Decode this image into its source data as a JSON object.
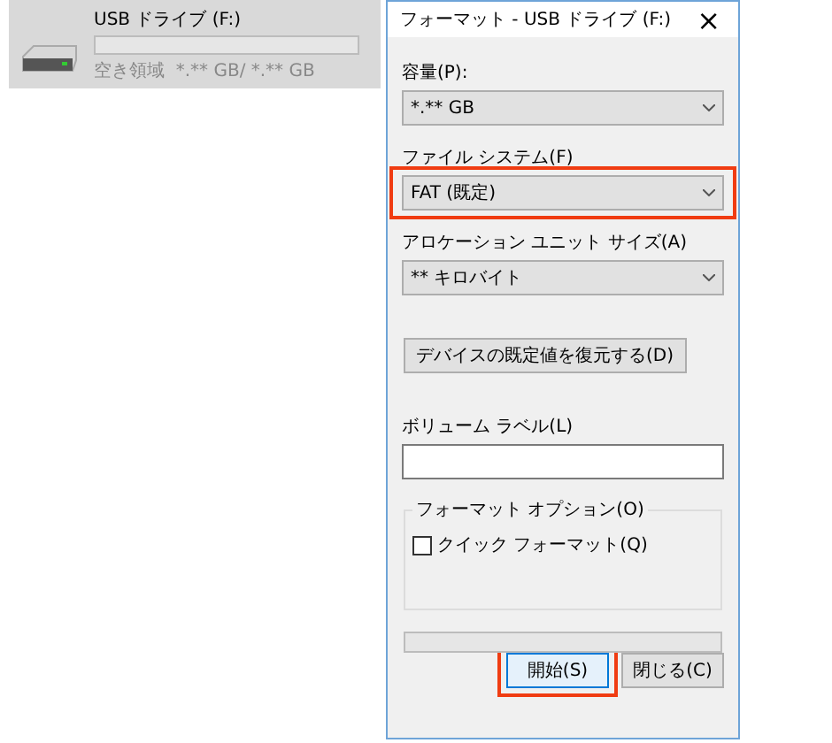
{
  "drive_tile": {
    "name": "USB ドライブ (F:)",
    "level": 0,
    "free_space": "空き領域  *.** GB/ *.** GB"
  },
  "dialog": {
    "title": "フォーマット - USB ドライブ (F:)",
    "close": "×",
    "fields": [
      {
        "kind": "combo",
        "label": "容量(P):",
        "value": "*.** GB",
        "highlighted": false
      },
      {
        "kind": "combo",
        "label": "ファイル システム(F)",
        "value": "FAT (既定)",
        "highlighted": true
      },
      {
        "kind": "combo",
        "label": "アロケーション ユニット サイズ(A)",
        "value": "** キロバイト",
        "highlighted": false
      },
      {
        "kind": "button",
        "label": "デバイスの既定値を復元する(D)"
      },
      {
        "kind": "text",
        "label": "ボリューム ラベル(L)"
      }
    ],
    "options_group": {
      "title": "フォーマット オプション(O)",
      "checkboxes": [
        {
          "label": "クイック フォーマット(Q)",
          "checked": false
        }
      ]
    },
    "progress": {
      "level": 0
    },
    "buttons": [
      {
        "label": "開始(S)",
        "default": true,
        "highlighted": true
      },
      {
        "label": "閉じる(C)",
        "default": false,
        "highlighted": false
      }
    ]
  }
}
